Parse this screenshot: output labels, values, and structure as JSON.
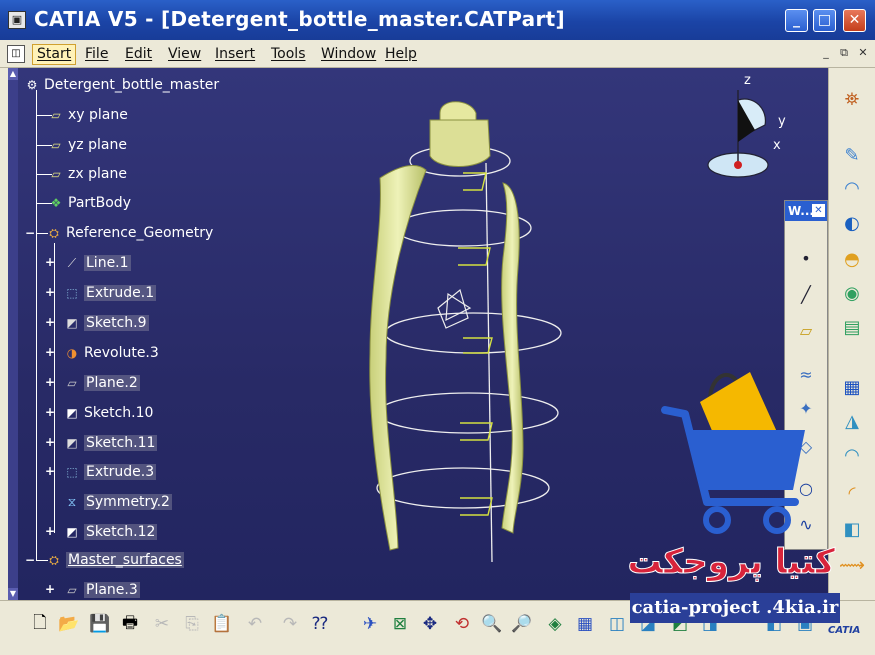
{
  "window": {
    "title": "CATIA V5 - [Detergent_bottle_master.CATPart]",
    "app_icon": "catia-app-icon",
    "minimize": "_",
    "maximize": "□",
    "close": "✕"
  },
  "menubar": {
    "items": [
      "Start",
      "File",
      "Edit",
      "View",
      "Insert",
      "Tools",
      "Window",
      "Help"
    ],
    "mdi_minimize": "_",
    "mdi_restore": "⧉",
    "mdi_close": "✕"
  },
  "tree": {
    "root": "Detergent_bottle_master",
    "planes": [
      "xy plane",
      "yz plane",
      "zx plane"
    ],
    "partbody": "PartBody",
    "reference_geometry": "Reference_Geometry",
    "features": [
      {
        "label": "Line.1",
        "icon": "line-icon"
      },
      {
        "label": "Extrude.1",
        "icon": "extrude-icon"
      },
      {
        "label": "Sketch.9",
        "icon": "sketch-icon"
      },
      {
        "label": "Revolute.3",
        "icon": "revolute-icon"
      },
      {
        "label": "Plane.2",
        "icon": "plane-icon"
      },
      {
        "label": "Sketch.10",
        "icon": "sketch-icon"
      },
      {
        "label": "Sketch.11",
        "icon": "sketch-icon"
      },
      {
        "label": "Extrude.3",
        "icon": "extrude-icon"
      },
      {
        "label": "Symmetry.2",
        "icon": "symmetry-icon"
      },
      {
        "label": "Sketch.12",
        "icon": "sketch-icon"
      }
    ],
    "master_surfaces": "Master_surfaces",
    "last_child": "Plane.3"
  },
  "compass": {
    "z": "z",
    "y": "y",
    "x": "x"
  },
  "wireframe_toolbar": {
    "title": "W..."
  },
  "watermark": {
    "brand_fa": "کتیا پروجکت",
    "url": "catia-project .4kia.ir"
  },
  "logo": "CATIA",
  "colors": {
    "viewport_bg": "#2a2d6a",
    "geometry": "#e6ecaa",
    "titlebar": "#1b44a6",
    "watermark_red": "#d8233b",
    "watermark_blue": "#2a5fd0",
    "watermark_yellow": "#f5b800"
  }
}
